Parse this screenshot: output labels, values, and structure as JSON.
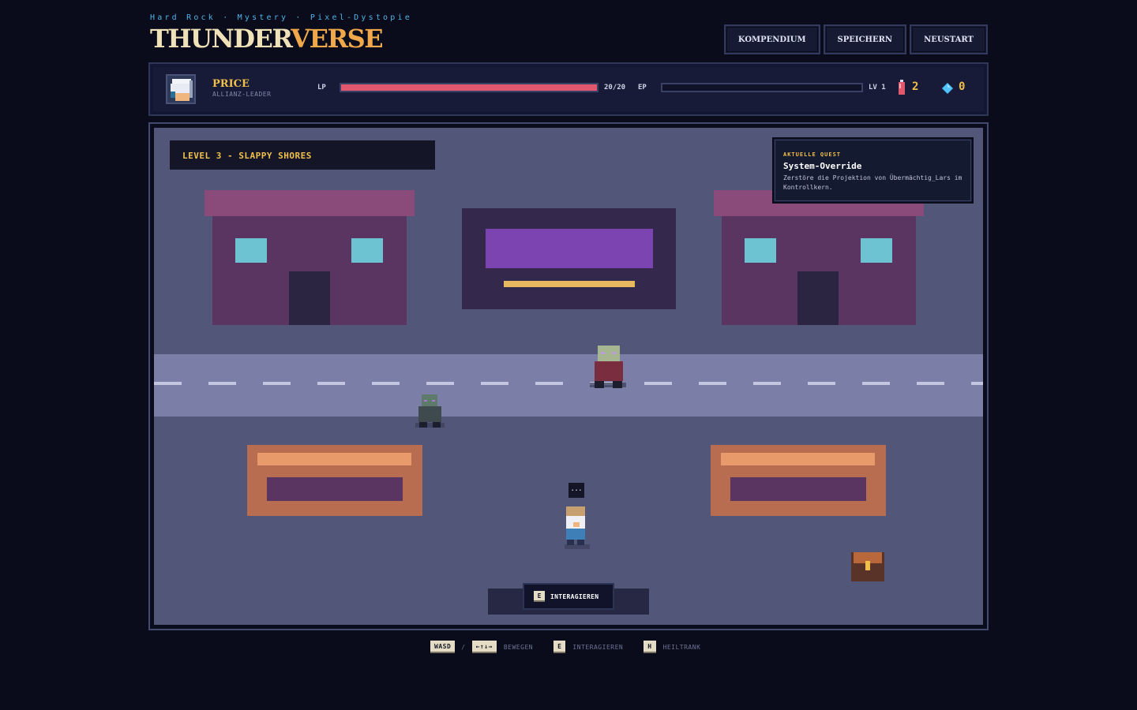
{
  "header": {
    "tagline": "Hard Rock · Mystery · Pixel-Dystopie",
    "logo_part1": "THUNDER",
    "logo_part2": "VERSE",
    "buttons": {
      "compendium": "KOMPENDIUM",
      "save": "SPEICHERN",
      "restart": "NEUSTART"
    }
  },
  "hud": {
    "name": "PRICE",
    "role": "ALLIANZ-LEADER",
    "lp_label": "LP",
    "lp_value": "20/20",
    "lp_fraction": 1.0,
    "ep_label": "EP",
    "ep_fraction": 0.0,
    "level": "LV 1",
    "potions": "2",
    "gems": "0",
    "colors": {
      "lp_bar": "#e0576e",
      "potion": "#e0576e",
      "gem": "#4fc3f7",
      "accent": "#f0c04a"
    }
  },
  "game": {
    "level_title": "LEVEL 3 - SLAPPY SHORES",
    "quest": {
      "kicker": "AKTUELLE QUEST",
      "title": "System-Override",
      "description": "Zerstöre die Projektion von Übermächtig_Lars im Kontrollkern."
    },
    "player_speech": "...",
    "interact_key": "E",
    "interact_label": "INTERAGIEREN"
  },
  "controls": {
    "move_key1": "WASD",
    "separator": "/",
    "move_key2": "←↑↓→",
    "move_label": "BEWEGEN",
    "interact_key": "E",
    "interact_label": "INTERAGIEREN",
    "heal_key": "H",
    "heal_label": "HEILTRANK"
  }
}
